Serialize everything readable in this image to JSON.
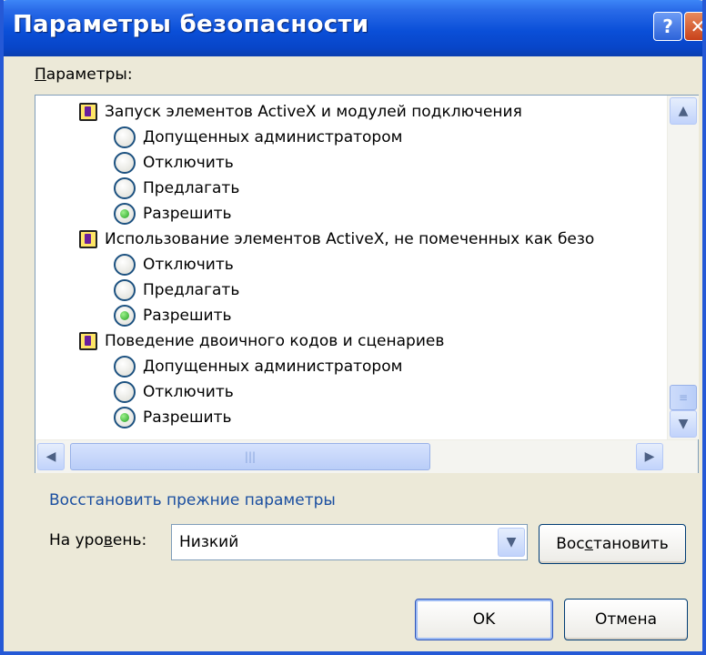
{
  "window": {
    "title": "Параметры безопасности",
    "help_glyph": "?",
    "close_glyph": "✕"
  },
  "params": {
    "label_prefix": "П",
    "label_rest": "араметры:"
  },
  "list": [
    {
      "type": "category",
      "text": "Запуск элементов ActiveX и модулей подключения"
    },
    {
      "type": "option",
      "text": "Допущенных администратором",
      "checked": false
    },
    {
      "type": "option",
      "text": "Отключить",
      "checked": false
    },
    {
      "type": "option",
      "text": "Предлагать",
      "checked": false
    },
    {
      "type": "option",
      "text": "Разрешить",
      "checked": true
    },
    {
      "type": "category",
      "text": "Использование элементов ActiveX, не помеченных как безо"
    },
    {
      "type": "option",
      "text": "Отключить",
      "checked": false
    },
    {
      "type": "option",
      "text": "Предлагать",
      "checked": false
    },
    {
      "type": "option",
      "text": "Разрешить",
      "checked": true
    },
    {
      "type": "category",
      "text": "Поведение двоичного кодов и сценариев"
    },
    {
      "type": "option",
      "text": "Допущенных администратором",
      "checked": false
    },
    {
      "type": "option",
      "text": "Отключить",
      "checked": false
    },
    {
      "type": "option",
      "text": "Разрешить",
      "checked": true
    }
  ],
  "scrollbars": {
    "up": "▲",
    "down": "▼",
    "left": "◀",
    "right": "▶",
    "grip_v": "≡",
    "grip_h": "|||"
  },
  "restore_group": {
    "title": "Восстановить прежние параметры"
  },
  "level": {
    "label_before": "На уро",
    "label_underlined": "в",
    "label_after": "ень:",
    "value": "Низкий",
    "dropdown_glyph": "▼"
  },
  "buttons": {
    "restore_before": "Вос",
    "restore_underlined": "с",
    "restore_after": "тановить",
    "ok": "OK",
    "cancel": "Отмена"
  }
}
